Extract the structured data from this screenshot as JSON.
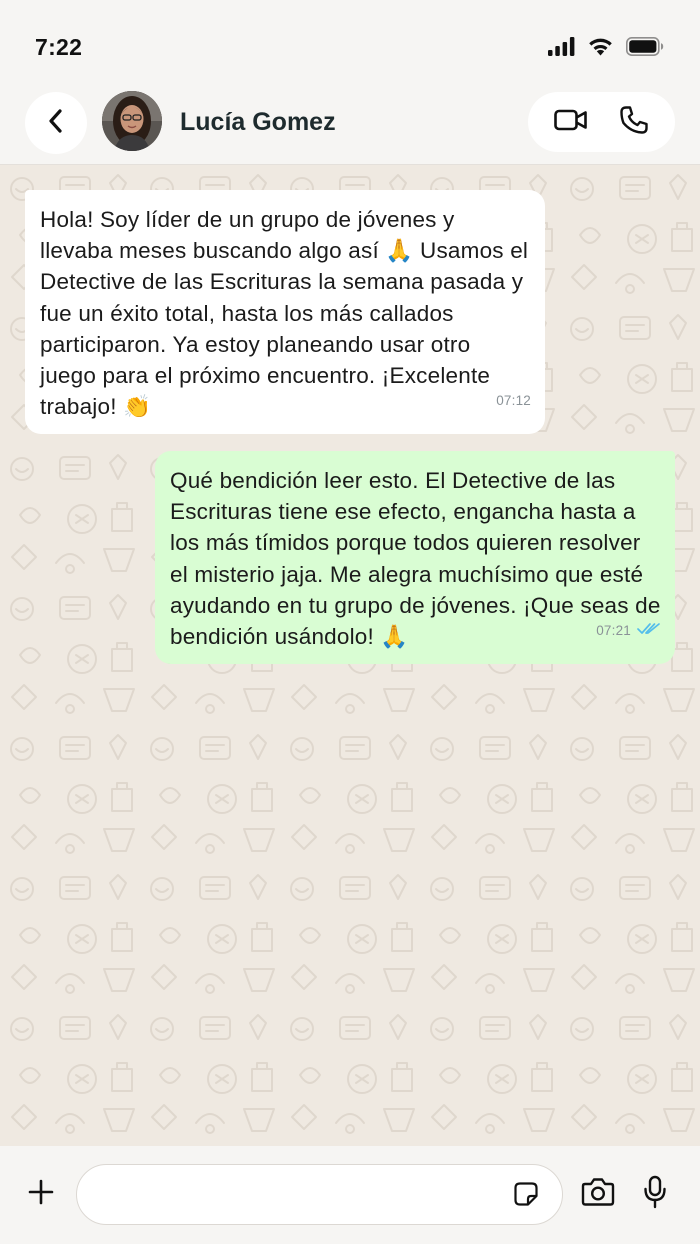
{
  "status_bar": {
    "time": "7:22"
  },
  "header": {
    "contact_name": "Lucía Gomez"
  },
  "messages": [
    {
      "direction": "incoming",
      "text": "Hola! Soy líder de un grupo de jóvenes y llevaba meses buscando algo así 🙏 Usamos el Detective de las Escrituras la semana pasada y fue un éxito total, hasta los más callados participaron. Ya estoy planeando usar otro juego para el próximo encuentro. ¡Excelente trabajo! 👏",
      "time": "07:12"
    },
    {
      "direction": "outgoing",
      "text": "Qué bendición leer esto. El Detective de las Escrituras tiene ese efecto, engancha hasta a los más tímidos porque todos quieren resolver el misterio jaja. Me alegra muchísimo que esté ayudando en tu grupo de jóvenes. ¡Que seas de bendición usándolo! 🙏",
      "time": "07:21",
      "status": "read"
    }
  ],
  "input": {
    "value": "",
    "placeholder": ""
  },
  "colors": {
    "incoming_bubble": "#ffffff",
    "outgoing_bubble": "#d9fdd3",
    "read_ticks": "#53bdeb",
    "chat_background": "#efe9e1"
  },
  "icons": {
    "back": "chevron-left-icon",
    "video": "video-camera-icon",
    "call": "phone-icon",
    "attach": "plus-icon",
    "sticker": "sticker-icon",
    "camera": "camera-icon",
    "mic": "microphone-icon"
  }
}
